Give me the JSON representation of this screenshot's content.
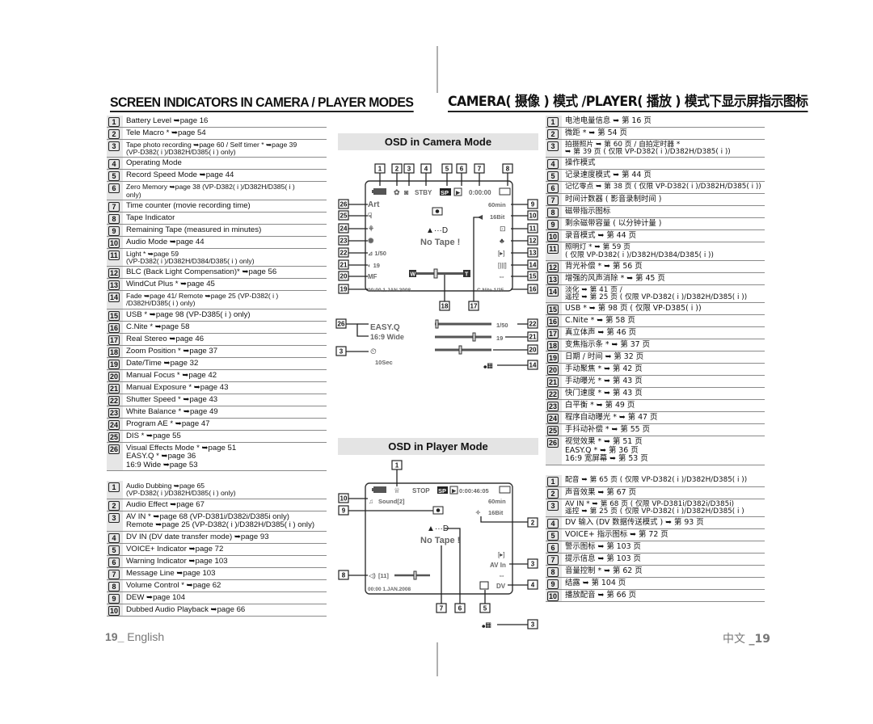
{
  "headings": {
    "english": "SCREEN INDICATORS IN CAMERA / PLAYER MODES",
    "chinese": "CAMERA( 摄像 ) 模式 /PLAYER( 播放 ) 模式下显示屏指示图标"
  },
  "camera_list_en": [
    {
      "n": "1",
      "t": "Battery Level ➥page 16"
    },
    {
      "n": "2",
      "t": "Tele Macro * ➥page 54"
    },
    {
      "n": "3",
      "t": "Tape photo recording ➥page 60 / Self timer * ➥page 39\n(VP-D382( i )/D382H/D385( i ) only)"
    },
    {
      "n": "4",
      "t": "Operating Mode"
    },
    {
      "n": "5",
      "t": "Record Speed Mode ➥page 44"
    },
    {
      "n": "6",
      "t": "Zero Memory ➥page 38 (VP-D382( i )/D382H/D385( i )\nonly)"
    },
    {
      "n": "7",
      "t": "Time counter (movie recording time)"
    },
    {
      "n": "8",
      "t": "Tape Indicator"
    },
    {
      "n": "9",
      "t": "Remaining Tape (measured in minutes)"
    },
    {
      "n": "10",
      "t": "Audio Mode ➥page 44"
    },
    {
      "n": "11",
      "t": "Light * ➥page 59\n(VP-D382( i )/D382H/D384/D385( i ) only)"
    },
    {
      "n": "12",
      "t": "BLC (Back Light Compensation)* ➥page 56"
    },
    {
      "n": "13",
      "t": "WindCut Plus * ➥page 45"
    },
    {
      "n": "14",
      "t": "Fade ➥page 41/ Remote ➥page 25 (VP-D382( i )\n/D382H/D385( i ) only)"
    },
    {
      "n": "15",
      "t": "USB * ➥page 98 (VP-D385( i ) only)"
    },
    {
      "n": "16",
      "t": "C.Nite * ➥page 58"
    },
    {
      "n": "17",
      "t": "Real Stereo ➥page 46"
    },
    {
      "n": "18",
      "t": "Zoom Position * ➥page 37"
    },
    {
      "n": "19",
      "t": "Date/Time  ➥page 32"
    },
    {
      "n": "20",
      "t": "Manual Focus * ➥page 42"
    },
    {
      "n": "21",
      "t": "Manual Exposure * ➥page 43"
    },
    {
      "n": "22",
      "t": "Shutter Speed * ➥page 43"
    },
    {
      "n": "23",
      "t": "White Balance * ➥page 49"
    },
    {
      "n": "24",
      "t": "Program AE * ➥page 47"
    },
    {
      "n": "25",
      "t": "DIS * ➥page 55"
    },
    {
      "n": "26",
      "t": "Visual Effects Mode * ➥page 51\nEASY.Q * ➥page 36\n16:9 Wide ➥page 53"
    }
  ],
  "player_list_en": [
    {
      "n": "1",
      "t": "Audio Dubbing ➥page 65\n(VP-D382( i )/D382H/D385( i ) only)"
    },
    {
      "n": "2",
      "t": "Audio Effect ➥page 67"
    },
    {
      "n": "3",
      "t": "AV IN * ➥page 68 (VP-D381i/D382i/D385i only)\nRemote ➥page 25 (VP-D382( i )/D382H/D385( i ) only)"
    },
    {
      "n": "4",
      "t": "DV IN (DV date transfer mode) ➥page 93"
    },
    {
      "n": "5",
      "t": "VOICE+ Indicator ➥page 72"
    },
    {
      "n": "6",
      "t": "Warning Indicator ➥page 103"
    },
    {
      "n": "7",
      "t": "Message Line ➥page 103"
    },
    {
      "n": "8",
      "t": "Volume Control * ➥page 62"
    },
    {
      "n": "9",
      "t": "DEW ➥page 104"
    },
    {
      "n": "10",
      "t": "Dubbed Audio Playback ➥page 66"
    }
  ],
  "camera_list_zh": [
    {
      "n": "1",
      "t": "电池电量信息 ➥ 第 16 页"
    },
    {
      "n": "2",
      "t": "微距 * ➥ 第 54 页"
    },
    {
      "n": "3",
      "t": "拍摄照片 ➥ 第 60 页 / 自拍定时器 *\n➥ 第 39 页 ( 仅限 VP-D382( i )/D382H/D385( i ))"
    },
    {
      "n": "4",
      "t": "操作模式"
    },
    {
      "n": "5",
      "t": "记录速度模式 ➥ 第 44 页"
    },
    {
      "n": "6",
      "t": "记忆零点 ➥ 第 38 页 ( 仅限 VP-D382( i )/D382H/D385( i ))"
    },
    {
      "n": "7",
      "t": "时间计数器 ( 影音录制时间 )"
    },
    {
      "n": "8",
      "t": "磁带指示图标"
    },
    {
      "n": "9",
      "t": "剩余磁带容量 ( 以分钟计量 )"
    },
    {
      "n": "10",
      "t": "录音模式 ➥ 第 44 页"
    },
    {
      "n": "11",
      "t": "照明灯 * ➥ 第 59 页\n( 仅限 VP-D382( i )/D382H/D384/D385( i ))"
    },
    {
      "n": "12",
      "t": "背光补偿 * ➥ 第 56 页"
    },
    {
      "n": "13",
      "t": "增强的风声消除 * ➥ 第 45 页"
    },
    {
      "n": "14",
      "t": "淡化 ➥ 第 41 页 /\n遥控 ➥ 第 25 页 ( 仅限 VP-D382( i )/D382H/D385( i ))"
    },
    {
      "n": "15",
      "t": "USB * ➥ 第 98 页 ( 仅限 VP-D385( i ))"
    },
    {
      "n": "16",
      "t": "C.Nite * ➥ 第 58 页"
    },
    {
      "n": "17",
      "t": "真立体声 ➥ 第 46 页"
    },
    {
      "n": "18",
      "t": "变焦指示条 * ➥ 第 37 页"
    },
    {
      "n": "19",
      "t": "日期 / 时间 ➥ 第 32 页"
    },
    {
      "n": "20",
      "t": "手动聚焦 * ➥ 第 42 页"
    },
    {
      "n": "21",
      "t": "手动曝光 * ➥ 第 43 页"
    },
    {
      "n": "22",
      "t": "快门速度 * ➥ 第 43 页"
    },
    {
      "n": "23",
      "t": "白平衡 * ➥ 第 49 页"
    },
    {
      "n": "24",
      "t": "程序自动曝光 * ➥ 第 47 页"
    },
    {
      "n": "25",
      "t": "手抖动补偿 * ➥ 第 55 页"
    },
    {
      "n": "26",
      "t": "视觉效果 * ➥ 第 51 页\nEASY.Q * ➥ 第 36 页\n16:9 宽屏幕 ➥ 第 53 页"
    }
  ],
  "player_list_zh": [
    {
      "n": "1",
      "t": "配音 ➥ 第 65 页 ( 仅限 VP-D382( i )/D382H/D385( i ))"
    },
    {
      "n": "2",
      "t": "声音效果 ➥ 第 67 页"
    },
    {
      "n": "3",
      "t": "AV IN * ➥ 第 68 页 ( 仅限 VP-D381i/D382i/D385i)\n遥控 ➥ 第 25 页 ( 仅限 VP-D382( i )/D382H/D385( i )"
    },
    {
      "n": "4",
      "t": "DV 输入 (DV 数据传送模式 ) ➥ 第 93 页"
    },
    {
      "n": "5",
      "t": "VOICE+ 指示图标 ➥ 第 72 页"
    },
    {
      "n": "6",
      "t": "警示图标 ➥ 第 103 页"
    },
    {
      "n": "7",
      "t": "提示信息 ➥ 第 103 页"
    },
    {
      "n": "8",
      "t": "音量控制 * ➥ 第 62 页"
    },
    {
      "n": "9",
      "t": "结露 ➥ 第 104 页"
    },
    {
      "n": "10",
      "t": "播放配音 ➥ 第 66 页"
    }
  ],
  "osd_camera": {
    "title": "OSD in Camera Mode",
    "stby": "STBY",
    "sp": "SP",
    "counter": "0:00:00",
    "art": "Art",
    "remaining": "60min",
    "audio_mode": "16Bit",
    "no_tape": "No Tape !",
    "eject": "▲···D",
    "shutter": "1/50",
    "exposure": "19",
    "mf": "MF",
    "zoom_w": "W",
    "zoom_t": "T",
    "datetime": "00:00  1.JAN.2008",
    "cnite": "C.Nite 1/25",
    "easyq": "EASY.Q",
    "wide": "16:9 Wide",
    "selftimer": "10Sec",
    "slider_shutter": "1/50",
    "slider_exposure": "19",
    "callouts_top": [
      "1",
      "2",
      "3",
      "4",
      "5",
      "6",
      "7",
      "8"
    ],
    "callouts_right": [
      "9",
      "10",
      "11",
      "12",
      "13",
      "14",
      "15",
      "16"
    ],
    "callouts_left": [
      "26",
      "25",
      "24",
      "23",
      "22",
      "21",
      "20",
      "19"
    ],
    "callouts_bottom": [
      "18",
      "17"
    ],
    "callouts_extra": [
      "26",
      "3",
      "22",
      "21",
      "20",
      "14"
    ]
  },
  "osd_player": {
    "title": "OSD in Player Mode",
    "stop": "STOP",
    "sp": "SP",
    "counter": "0:00:46:05",
    "sound": "Sound[2]",
    "remaining": "60min",
    "audio_mode": "16Bit",
    "eject": "▲···D",
    "no_tape": "No Tape !",
    "av_in": "AV In",
    "dv": "DV",
    "volume": "[11]",
    "datetime": "00:00  1.JAN.2008",
    "callouts": [
      "1",
      "2",
      "3",
      "4",
      "5",
      "6",
      "7",
      "8",
      "9",
      "10",
      "3"
    ]
  },
  "footer": {
    "en_num": "19_",
    "en_label": "English",
    "zh_label": "中文",
    "zh_num": "_19"
  }
}
